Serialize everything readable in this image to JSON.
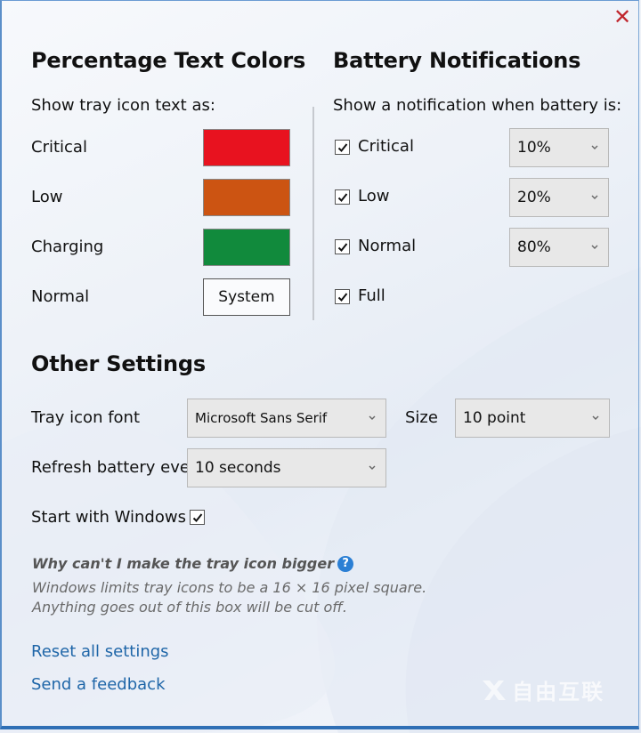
{
  "window": {
    "close_icon": "close-x-icon",
    "accent_color": "#c0262d"
  },
  "text_colors": {
    "title": "Percentage Text Colors",
    "subtitle": "Show tray icon text as:",
    "rows": [
      {
        "label": "Critical",
        "color": "#e8121f"
      },
      {
        "label": "Low",
        "color": "#cc5412"
      },
      {
        "label": "Charging",
        "color": "#118a3c"
      },
      {
        "label": "Normal",
        "button_label": "System"
      }
    ]
  },
  "notifications": {
    "title": "Battery Notifications",
    "subtitle": "Show a notification when battery is:",
    "rows": [
      {
        "label": "Critical",
        "checked": true,
        "value": "10%"
      },
      {
        "label": "Low",
        "checked": true,
        "value": "20%"
      },
      {
        "label": "Normal",
        "checked": true,
        "value": "80%"
      },
      {
        "label": "Full",
        "checked": true
      }
    ]
  },
  "other": {
    "title": "Other Settings",
    "font_label": "Tray icon font",
    "font_value": "Microsoft Sans Serif",
    "size_label": "Size",
    "size_value": "10 point",
    "refresh_label": "Refresh battery ever",
    "refresh_value": "10 seconds",
    "start_label": "Start with Windows",
    "start_checked": true
  },
  "help": {
    "question": "Why can't I make the tray icon bigger",
    "help_icon": "?",
    "answer_line1": "Windows limits tray icons to be a 16 × 16 pixel square.",
    "answer_line2": "Anything goes out of this box will be cut off."
  },
  "links": {
    "reset": "Reset all settings",
    "feedback": "Send a feedback"
  },
  "watermark": {
    "text": "自由互联"
  }
}
